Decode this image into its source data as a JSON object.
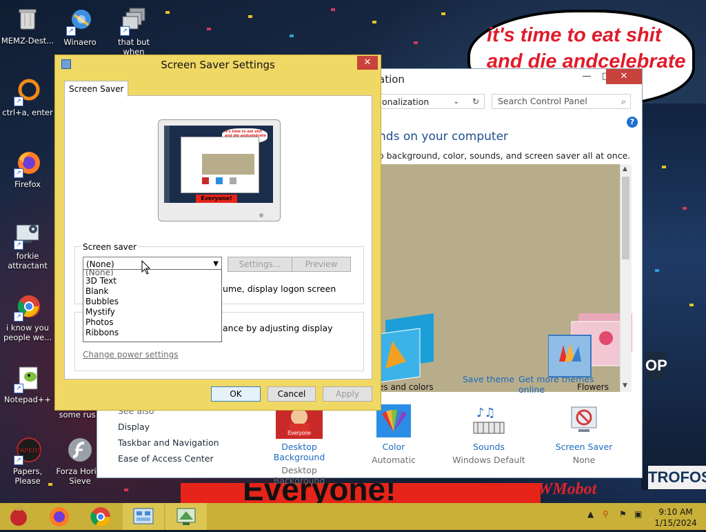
{
  "desktop": {
    "icons": [
      {
        "label": "MEMZ-Dest...",
        "icon": "recycle-bin-icon"
      },
      {
        "label": "Winaero",
        "icon": "winaero-icon"
      },
      {
        "label": "that but when",
        "icon": "stack-windows-icon"
      },
      {
        "label": "ctrl+a, enter",
        "icon": "orange-ring-icon"
      },
      {
        "label": "Firefox",
        "icon": "firefox-icon"
      },
      {
        "label": "forkie attractant",
        "icon": "computer-settings-icon"
      },
      {
        "label": "i know you people we...",
        "icon": "chrome-icon"
      },
      {
        "label": "Notepad++",
        "icon": "notepadpp-icon"
      },
      {
        "label": "some rus",
        "icon": "document-icon"
      },
      {
        "label": "Papers, Please",
        "icon": "papers-please-icon"
      },
      {
        "label": "Forza Hori... Sieve",
        "icon": "flash-icon"
      }
    ],
    "bubble_text": "it's time to eat shit and die andcelebrate",
    "banner_text": "Everyone!",
    "watermark_text": "WMobot"
  },
  "control_panel": {
    "title": "ation",
    "address": "onalization",
    "search_placeholder": "Search Control Panel",
    "heading": "nds on your computer",
    "subheading": "o background, color, sounds, and screen saver all at once.",
    "save_theme": "Save theme",
    "get_more_themes": "Get more themes online",
    "themes": [
      {
        "label": "es and colors"
      },
      {
        "label": "Flowers"
      }
    ],
    "see_also_title": "See also",
    "see_also": [
      "Display",
      "Taskbar and Navigation",
      "Ease of Access Center"
    ],
    "bottom_items": [
      {
        "link": "Desktop Background",
        "value": "Desktop Background"
      },
      {
        "link": "Color",
        "value": "Automatic"
      },
      {
        "link": "Sounds",
        "value": "Windows Default"
      },
      {
        "link": "Screen Saver",
        "value": "None"
      }
    ]
  },
  "dialog": {
    "title": "Screen Saver Settings",
    "tab": "Screen Saver",
    "group_label": "Screen saver",
    "selected": "(None)",
    "settings_button": "Settings...",
    "preview_button": "Preview",
    "resume_text": "ume, display logon screen",
    "power_text": "ance by adjusting display",
    "power_link": "Change power settings",
    "options": [
      "(None)",
      "3D Text",
      "Blank",
      "Bubbles",
      "Mystify",
      "Photos",
      "Ribbons"
    ],
    "ok": "OK",
    "cancel": "Cancel",
    "apply": "Apply",
    "close_glyph": "✕",
    "preview_bubble": "it's time to eat shit and die andcelebrate",
    "preview_banner": "Everyone!"
  },
  "taskbar": {
    "time": "9:10 AM",
    "date": "1/15/2024",
    "accent": "#c9b038"
  }
}
